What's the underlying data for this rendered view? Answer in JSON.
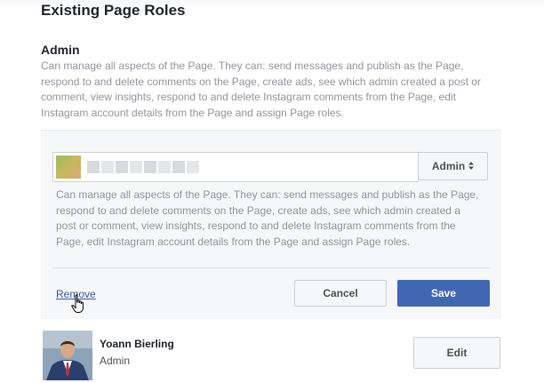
{
  "section": {
    "title": "Existing Page Roles"
  },
  "admin_role": {
    "title": "Admin",
    "description": "Can manage all aspects of the Page. They can: send messages and publish as the Page, respond to and delete comments on the Page, create ads, see which admin created a post or comment, view insights, respond to and delete Instagram comments from the Page, edit Instagram account details from the Page and assign Page roles."
  },
  "edit_panel": {
    "role_select": {
      "selected": "Admin",
      "icon": "updown-arrows-icon"
    },
    "description": "Can manage all aspects of the Page. They can: send messages and publish as the Page, respond to and delete comments on the Page, create ads, see which admin created a post or comment, view insights, respond to and delete Instagram comments from the Page, edit Instagram account details from the Page and assign Page roles.",
    "remove_label": "Remove",
    "cancel_label": "Cancel",
    "save_label": "Save"
  },
  "members": [
    {
      "name": "Yoann Bierling",
      "role": "Admin",
      "edit_label": "Edit"
    }
  ],
  "colors": {
    "accent": "#4267b2",
    "link": "#365899",
    "muted_text": "#90949c",
    "panel_bg": "#f6f7f9"
  }
}
